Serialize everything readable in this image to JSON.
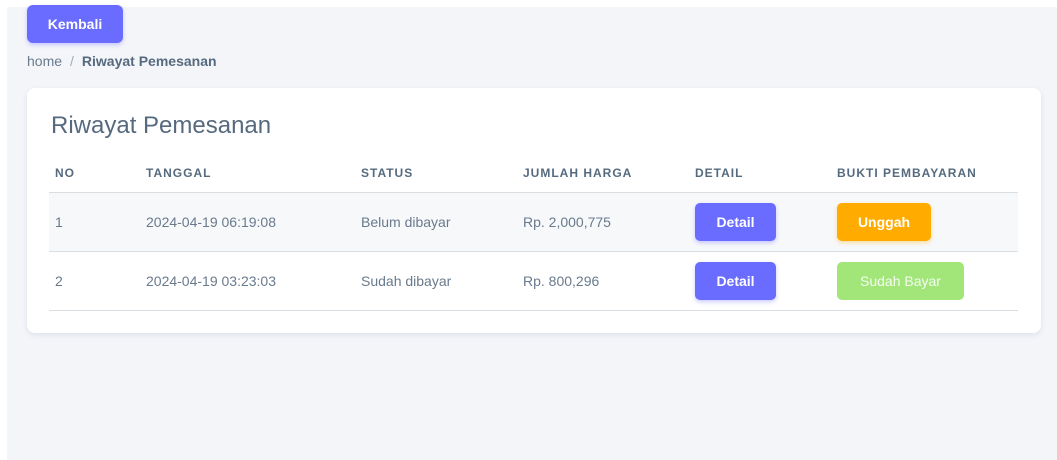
{
  "toolbar": {
    "back_label": "Kembali"
  },
  "breadcrumb": {
    "home": "home",
    "separator": "/",
    "current": "Riwayat Pemesanan"
  },
  "card": {
    "title": "Riwayat Pemesanan"
  },
  "table": {
    "headers": {
      "no": "NO",
      "tanggal": "TANGGAL",
      "status": "STATUS",
      "jumlah_harga": "JUMLAH HARGA",
      "detail": "DETAIL",
      "bukti": "BUKTI PEMBAYARAN"
    },
    "rows": [
      {
        "no": "1",
        "tanggal": "2024-04-19 06:19:08",
        "status": "Belum dibayar",
        "jumlah_harga": "Rp. 2,000,775",
        "detail_label": "Detail",
        "bukti_label": "Unggah"
      },
      {
        "no": "2",
        "tanggal": "2024-04-19 03:23:03",
        "status": "Sudah dibayar",
        "jumlah_harga": "Rp. 800,296",
        "detail_label": "Detail",
        "bukti_label": "Sudah Bayar"
      }
    ]
  },
  "colors": {
    "primary": "#696cff",
    "warning": "#ffab00",
    "success_light": "#a2e67a",
    "background": "#f4f5f9",
    "text": "#566a7f"
  }
}
